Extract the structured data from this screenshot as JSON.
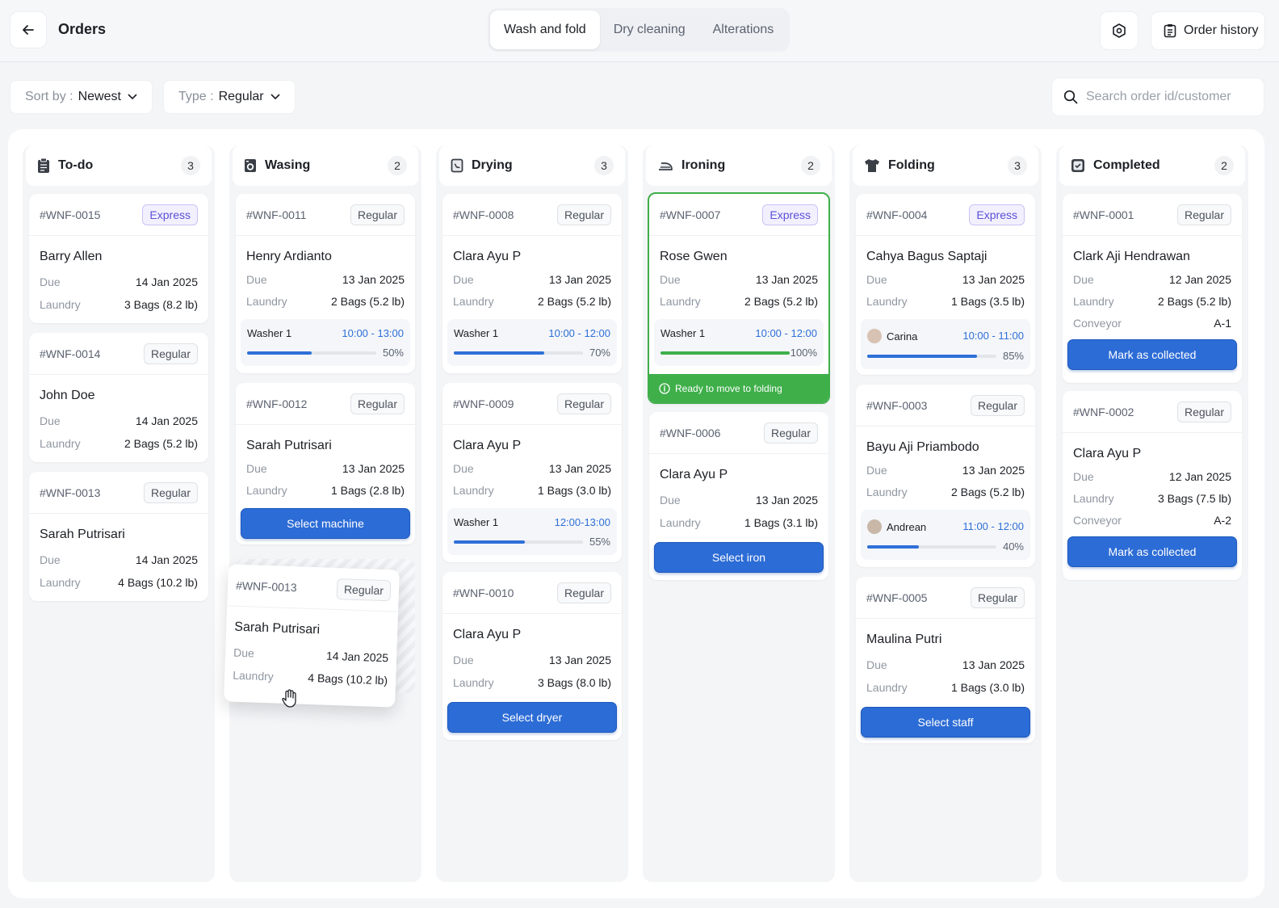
{
  "header": {
    "title": "Orders",
    "tabs": [
      {
        "label": "Wash and fold",
        "active": true
      },
      {
        "label": "Dry cleaning",
        "active": false
      },
      {
        "label": "Alterations",
        "active": false
      }
    ],
    "history_label": "Order history"
  },
  "filters": {
    "sort_label": "Sort by :",
    "sort_value": "Newest",
    "type_label": "Type :",
    "type_value": "Regular",
    "search_placeholder": "Search order id/customer"
  },
  "labels": {
    "due": "Due",
    "laundry": "Laundry",
    "conveyor": "Conveyor"
  },
  "colors": {
    "accent": "#2c6cd6",
    "success": "#3faf4a",
    "express": "#5b4fd6"
  },
  "columns": [
    {
      "title": "To-do",
      "count": "3",
      "icon": "clipboard-icon",
      "cards": [
        {
          "id": "#WNF-0015",
          "badge": "Express",
          "name": "Barry Allen",
          "due": "14 Jan 2025",
          "laundry": "3 Bags (8.2 lb)"
        },
        {
          "id": "#WNF-0014",
          "badge": "Regular",
          "name": "John Doe",
          "due": "14 Jan 2025",
          "laundry": "2 Bags (5.2 lb)"
        },
        {
          "id": "#WNF-0013",
          "badge": "Regular",
          "name": "Sarah Putrisari",
          "due": "14 Jan 2025",
          "laundry": "4 Bags (10.2 lb)"
        }
      ]
    },
    {
      "title": "Wasing",
      "count": "2",
      "icon": "washing-machine-icon",
      "cards": [
        {
          "id": "#WNF-0011",
          "badge": "Regular",
          "name": "Henry Ardianto",
          "due": "13 Jan 2025",
          "laundry": "2 Bags (5.2 lb)",
          "machine": "Washer 1",
          "time": "10:00 - 13:00",
          "progress": 50,
          "progress_label": "50%"
        },
        {
          "id": "#WNF-0012",
          "badge": "Regular",
          "name": "Sarah Putrisari",
          "due": "13 Jan 2025",
          "laundry": "1 Bags (2.8 lb)",
          "action": "Select machine"
        }
      ],
      "dragging": {
        "id": "#WNF-0013",
        "badge": "Regular",
        "name": "Sarah Putrisari",
        "due": "14 Jan 2025",
        "laundry": "4 Bags (10.2 lb)"
      }
    },
    {
      "title": "Drying",
      "count": "3",
      "icon": "dryer-icon",
      "cards": [
        {
          "id": "#WNF-0008",
          "badge": "Regular",
          "name": "Clara Ayu P",
          "due": "13 Jan 2025",
          "laundry": "2 Bags (5.2 lb)",
          "machine": "Washer 1",
          "time": "10:00 - 12:00",
          "progress": 70,
          "progress_label": "70%"
        },
        {
          "id": "#WNF-0009",
          "badge": "Regular",
          "name": "Clara Ayu P",
          "due": "13 Jan 2025",
          "laundry": "1 Bags (3.0 lb)",
          "machine": "Washer 1",
          "time": "12:00-13:00",
          "progress": 55,
          "progress_label": "55%"
        },
        {
          "id": "#WNF-0010",
          "badge": "Regular",
          "name": "Clara Ayu P",
          "due": "13 Jan 2025",
          "laundry": "3 Bags (8.0 lb)",
          "action": "Select dryer"
        }
      ]
    },
    {
      "title": "Ironing",
      "count": "2",
      "icon": "iron-icon",
      "cards": [
        {
          "id": "#WNF-0007",
          "badge": "Express",
          "name": "Rose Gwen",
          "due": "13 Jan 2025",
          "laundry": "2 Bags (5.2 lb)",
          "machine": "Washer 1",
          "time": "10:00 - 12:00",
          "progress": 100,
          "progress_label": "100%",
          "ready": "Ready to move to  folding"
        },
        {
          "id": "#WNF-0006",
          "badge": "Regular",
          "name": "Clara Ayu P",
          "due": "13 Jan 2025",
          "laundry": "1 Bags (3.1 lb)",
          "action": "Select iron"
        }
      ]
    },
    {
      "title": "Folding",
      "count": "3",
      "icon": "shirt-icon",
      "cards": [
        {
          "id": "#WNF-0004",
          "badge": "Express",
          "name": "Cahya Bagus Saptaji",
          "due": "13 Jan 2025",
          "laundry": "1 Bags (3.5 lb)",
          "staff": "Carina",
          "time": "10:00 - 11:00",
          "progress": 85,
          "progress_label": "85%"
        },
        {
          "id": "#WNF-0003",
          "badge": "Regular",
          "name": "Bayu Aji Priambodo",
          "due": "13 Jan 2025",
          "laundry": "2 Bags (5.2 lb)",
          "staff": "Andrean",
          "time": "11:00 - 12:00",
          "progress": 40,
          "progress_label": "40%"
        },
        {
          "id": "#WNF-0005",
          "badge": "Regular",
          "name": "Maulina Putri",
          "due": "13 Jan 2025",
          "laundry": "1 Bags (3.0 lb)",
          "action": "Select staff"
        }
      ]
    },
    {
      "title": "Completed",
      "count": "2",
      "icon": "check-box-icon",
      "cards": [
        {
          "id": "#WNF-0001",
          "badge": "Regular",
          "name": "Clark Aji Hendrawan",
          "due": "12 Jan 2025",
          "laundry": "2 Bags (5.2 lb)",
          "conveyor": "A-1",
          "action": "Mark as collected"
        },
        {
          "id": "#WNF-0002",
          "badge": "Regular",
          "name": "Clara Ayu P",
          "due": "12 Jan 2025",
          "laundry": "3 Bags (7.5 lb)",
          "conveyor": "A-2",
          "action": "Mark as collected"
        }
      ]
    }
  ]
}
